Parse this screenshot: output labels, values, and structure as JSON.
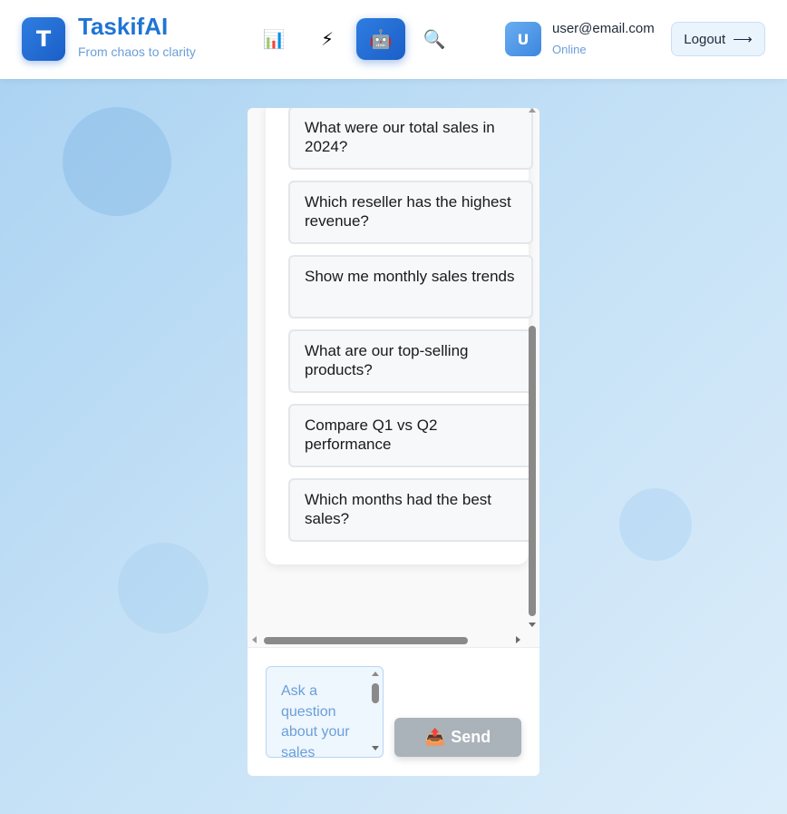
{
  "header": {
    "logo_letter": "T",
    "brand": "TaskifAI",
    "tagline": "From chaos to clarity",
    "nav": [
      {
        "icon": "📊",
        "name": "analytics"
      },
      {
        "icon": "⚡",
        "name": "automation"
      },
      {
        "icon": "🤖",
        "name": "ai-chat",
        "active": true
      },
      {
        "icon": "🔍",
        "name": "search"
      }
    ],
    "user": {
      "avatar_letter": "U",
      "email": "user@email.com",
      "status": "Online"
    },
    "logout_label": "Logout",
    "logout_arrow": "⟶"
  },
  "chat": {
    "suggestions": [
      "What were our total sales in 2024?",
      "Which reseller has the highest revenue?",
      "Show me monthly sales trends",
      "What are our top-selling products?",
      "Compare Q1 vs Q2 performance",
      "Which months had the best sales?"
    ],
    "input_placeholder": "Ask a question about your sales",
    "send_icon": "📤",
    "send_label": "Send"
  },
  "colors": {
    "accent": "#1f74d6",
    "header_bg": "#ffffff",
    "send_disabled": "#aab2ba"
  }
}
